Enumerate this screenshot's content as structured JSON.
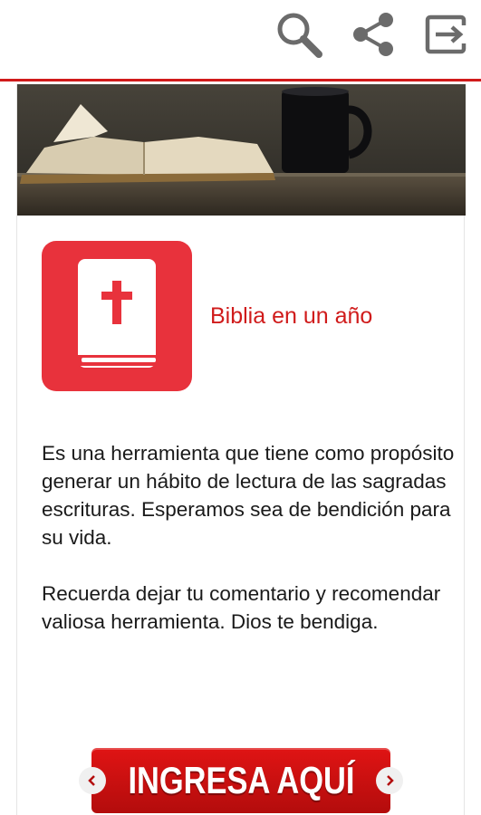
{
  "toolbar": {
    "icons": [
      "search-icon",
      "share-icon",
      "exit-icon"
    ]
  },
  "hero": {
    "image": "open-bible-and-coffee-mug"
  },
  "app": {
    "name": "Biblia en un año",
    "icon": "bible-cross-icon"
  },
  "description": {
    "paragraph1": "Es una herramienta que tiene como propósito generar un hábito de lectura de las sagradas escrituras. Esperamos sea de bendición para su vida.",
    "paragraph2": "Recuerda dejar tu comentario y recomendar valiosa herramienta. Dios te bendiga."
  },
  "cta": {
    "label": "INGRESA AQUÍ"
  },
  "colors": {
    "accent": "#d01b1b",
    "tile": "#e8323c"
  }
}
